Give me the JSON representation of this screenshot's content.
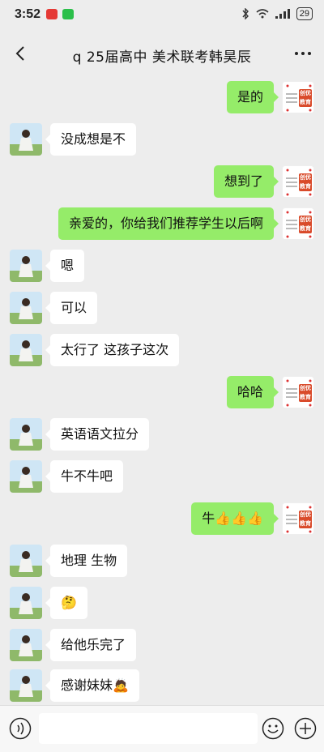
{
  "status": {
    "time": "3:52",
    "battery": "29"
  },
  "chat": {
    "title": "q  25届高中   美术联考韩昊辰"
  },
  "messages": [
    {
      "side": "out",
      "text": "是的"
    },
    {
      "side": "in",
      "text": "没成想是不"
    },
    {
      "side": "out",
      "text": "想到了"
    },
    {
      "side": "out",
      "text": "亲爱的，你给我们推荐学生以后啊"
    },
    {
      "side": "in",
      "text": "嗯"
    },
    {
      "side": "in",
      "text": "可以"
    },
    {
      "side": "in",
      "text": "太行了 这孩子这次"
    },
    {
      "side": "out",
      "text": "哈哈"
    },
    {
      "side": "in",
      "text": "英语语文拉分"
    },
    {
      "side": "in",
      "text": "牛不牛吧"
    },
    {
      "side": "out",
      "text": "牛👍👍👍"
    },
    {
      "side": "in",
      "text": "地理 生物"
    },
    {
      "side": "in",
      "text": "🤔"
    },
    {
      "side": "in",
      "text": "给他乐完了"
    },
    {
      "side": "in",
      "text": "感谢妹妹🙇"
    }
  ],
  "brand": {
    "logo_text_1": "创优",
    "logo_text_2": "教育",
    "bubble_out_color": "#95ec69",
    "bubble_in_color": "#ffffff",
    "background": "#ededed"
  },
  "icons": {
    "back": "chevron-left-icon",
    "more": "more-dots-icon",
    "voice": "voice-icon",
    "emoji": "emoji-icon",
    "plus": "plus-icon"
  }
}
